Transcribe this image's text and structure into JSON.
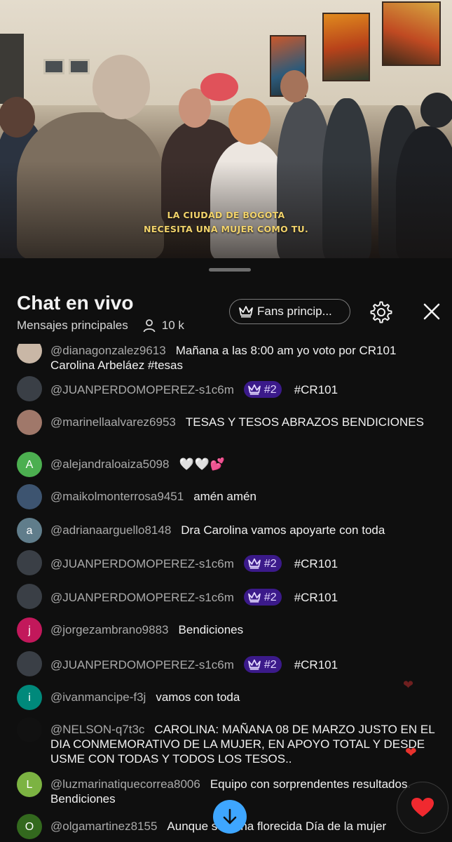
{
  "video": {
    "caption_line1": "LA CIUDAD DE BOGOTA",
    "caption_line2": "NECESITA UNA MUJER COMO TU."
  },
  "chat": {
    "title": "Chat en vivo",
    "subtitle": "Mensajes principales",
    "viewer_count": "10 k",
    "fans_button": "Fans princip...",
    "icons": {
      "viewers": "person-icon",
      "fans": "crown-icon",
      "settings": "gear-icon",
      "close": "close-icon",
      "scroll": "arrow-down-icon",
      "like": "heart-icon"
    },
    "accent_color": "#3ea6ff",
    "badge_color": "#3b1a8a"
  },
  "messages": [
    {
      "author": "@dianagonzalez9613",
      "text": "Mañana a las 8:00 am yo voto por CR101 Carolina Arbeláez #tesas",
      "avatar_letter": "",
      "avatar_color": "#c9b7a6"
    },
    {
      "author": "@JUANPERDOMOPEREZ-s1c6m",
      "badge": "#2",
      "text": "#CR101",
      "avatar_letter": "",
      "avatar_color": "#3a3f46"
    },
    {
      "author": "@marinellaalvarez6953",
      "text": "TESAS Y TESOS ABRAZOS BENDICIONES",
      "avatar_letter": "",
      "avatar_color": "#a0786a"
    },
    {
      "author": "@alejandraloaiza5098",
      "text": "🤍🤍💕",
      "avatar_letter": "A",
      "avatar_color": "#4caf50"
    },
    {
      "author": "@maikolmonterrosa9451",
      "text": "amén amén",
      "avatar_letter": "",
      "avatar_color": "#3d5470"
    },
    {
      "author": "@adrianaarguello8148",
      "text": "Dra Carolina vamos apoyarte con toda",
      "avatar_letter": "a",
      "avatar_color": "#607d8b"
    },
    {
      "author": "@JUANPERDOMOPEREZ-s1c6m",
      "badge": "#2",
      "text": "#CR101",
      "avatar_letter": "",
      "avatar_color": "#3a3f46"
    },
    {
      "author": "@JUANPERDOMOPEREZ-s1c6m",
      "badge": "#2",
      "text": "#CR101",
      "avatar_letter": "",
      "avatar_color": "#3a3f46"
    },
    {
      "author": "@jorgezambrano9883",
      "text": "Bendiciones",
      "avatar_letter": "j",
      "avatar_color": "#c2185b"
    },
    {
      "author": "@JUANPERDOMOPEREZ-s1c6m",
      "badge": "#2",
      "text": "#CR101",
      "avatar_letter": "",
      "avatar_color": "#3a3f46"
    },
    {
      "author": "@ivanmancipe-f3j",
      "text": "vamos con toda",
      "avatar_letter": "i",
      "avatar_color": "#00897b"
    },
    {
      "author": "@NELSON-q7t3c",
      "text": "CAROLINA: MAÑANA 08 DE MARZO JUSTO EN EL DIA CONMEMORATIVO DE LA MUJER, EN APOYO TOTAL Y DESDE USME CON TODAS Y TODOS LOS TESOS..",
      "avatar_letter": "",
      "avatar_color": "#111111"
    },
    {
      "author": "@luzmarinatiquecorrea8006",
      "text": "Equipo con sorprendentes resultados. Bendiciones",
      "avatar_letter": "L",
      "avatar_color": "#7cb342"
    },
    {
      "author": "@olgamartinez8155",
      "text": "Aunque sea una florecida Día de la mujer",
      "avatar_letter": "O",
      "avatar_color": "#33691e"
    }
  ]
}
